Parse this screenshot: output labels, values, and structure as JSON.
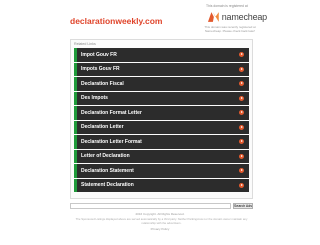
{
  "header": {
    "domain": "declarationweekly.com",
    "registered_notice": "This domain is registered at",
    "brand": "namecheap",
    "registrar_note": "This domain was recently registered at Namecheap. Please check back later!"
  },
  "related": {
    "label": "Related Links",
    "links": [
      {
        "label": "Impot Gouv FR"
      },
      {
        "label": "Impots Gouv FR"
      },
      {
        "label": "Declaration Fiscal"
      },
      {
        "label": "Des Impots"
      },
      {
        "label": "Declaration Format Letter"
      },
      {
        "label": "Declaration Letter"
      },
      {
        "label": "Declaration Letter Format"
      },
      {
        "label": "Letter of Declaration"
      },
      {
        "label": "Declaration Statement"
      },
      {
        "label": "Statement Declaration"
      }
    ]
  },
  "search": {
    "placeholder": "",
    "button_label": "Search Ads"
  },
  "footer": {
    "copyright": "2016 Copyright. All Rights Reserved.",
    "disclaimer": "The Sponsored Listings displayed above are served automatically by a third party. Neither Parkingcrew nor the domain owner maintain any relationship with the advertisers.",
    "privacy_label": "Privacy Policy"
  },
  "colors": {
    "domain": "#e0442a",
    "link_bg": "#2c2c2c",
    "link_accent": "#1f9a3a",
    "arrow": "#e35a2e",
    "brand_mark": "#e35a2e"
  }
}
